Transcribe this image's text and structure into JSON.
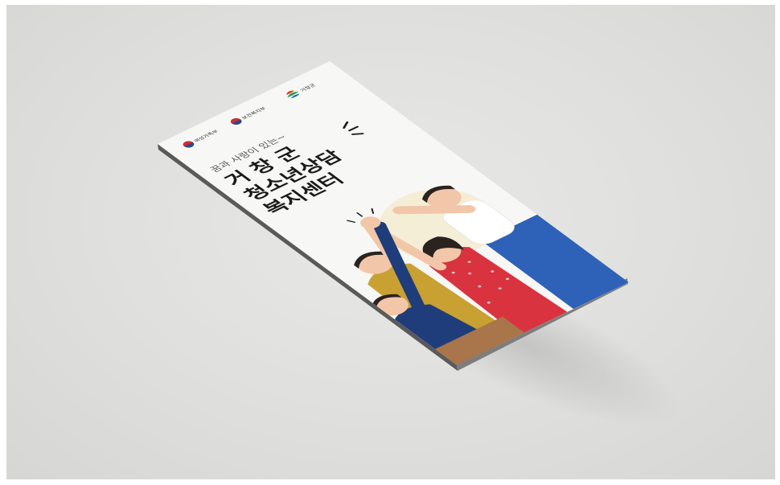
{
  "brochure": {
    "logos": [
      {
        "icon": "government-emblem-icon",
        "label": "여성가족부"
      },
      {
        "icon": "government-emblem-icon",
        "label": "보건복지부"
      },
      {
        "icon": "county-symbol-icon",
        "label": "거창군"
      }
    ],
    "subtitle": "꿈과 사랑이 있는~",
    "title_line1": "거 창 군",
    "title_line2": "청소년상담",
    "title_line3": "복지센터",
    "illustration": "people-high-five-illustration",
    "colors": {
      "background": "#dfdfdd",
      "paper": "#f7f7f5",
      "title": "#1a1a1a",
      "navy": "#1f3d7a",
      "mustard": "#c9a032",
      "red": "#d9333f",
      "blue": "#2d62b8"
    }
  }
}
